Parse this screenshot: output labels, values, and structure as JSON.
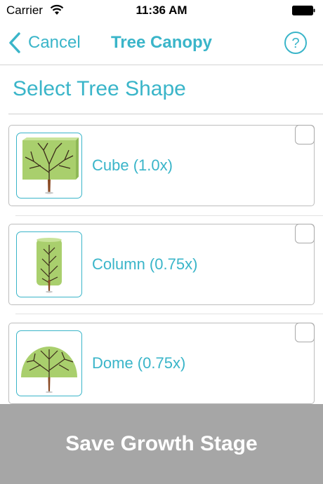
{
  "status_bar": {
    "carrier": "Carrier",
    "time": "11:36 AM"
  },
  "nav": {
    "back_label": "Cancel",
    "title": "Tree Canopy",
    "help_icon": "question-circle-icon"
  },
  "section": {
    "title": "Select Tree Shape"
  },
  "shapes": [
    {
      "label": "Cube (1.0x)",
      "icon": "cube-tree-icon",
      "checked": false
    },
    {
      "label": "Column (0.75x)",
      "icon": "column-tree-icon",
      "checked": false
    },
    {
      "label": "Dome (0.75x)",
      "icon": "dome-tree-icon",
      "checked": false
    }
  ],
  "save_button": {
    "label": "Save Growth Stage"
  },
  "colors": {
    "accent": "#3ab5c9",
    "save_bg": "#a6a6a6",
    "foliage": "#a9cf6d",
    "trunk": "#6b3a1f"
  }
}
